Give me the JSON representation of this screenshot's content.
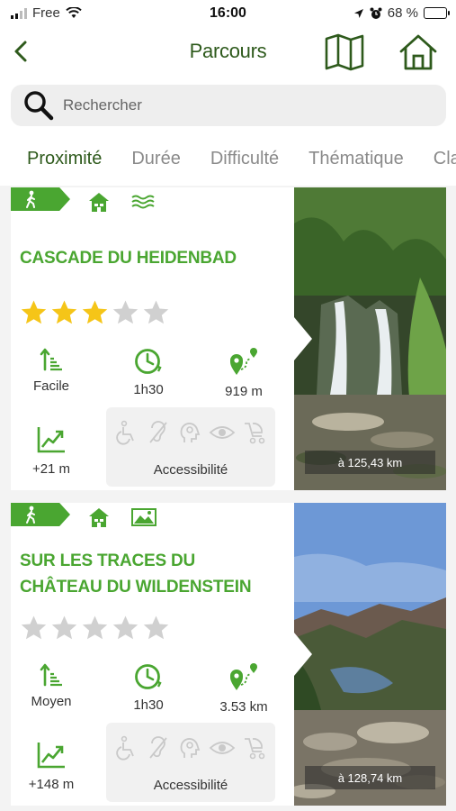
{
  "status_bar": {
    "carrier": "Free",
    "time": "16:00",
    "battery": "68 %",
    "battery_level": 0.68
  },
  "header": {
    "title": "Parcours",
    "back_icon": "chevron-left-icon",
    "map_icon": "map-icon",
    "home_icon": "home-icon"
  },
  "search": {
    "placeholder": "Rechercher",
    "value": ""
  },
  "tabs": [
    {
      "label": "Proximité",
      "active": true
    },
    {
      "label": "Durée",
      "active": false
    },
    {
      "label": "Difficulté",
      "active": false
    },
    {
      "label": "Thématique",
      "active": false
    },
    {
      "label": "Classem",
      "active": false
    }
  ],
  "colors": {
    "brand_green": "#4aa631",
    "title_green": "#2e5a1c",
    "star_gold": "#f5c518",
    "star_grey": "#d0d0d0"
  },
  "routes": [
    {
      "title": "Cascade du Heidenbad",
      "rating": 3,
      "max_rating": 5,
      "difficulty": "Facile",
      "duration": "1h30",
      "length": "919 m",
      "elevation": "+21 m",
      "accessibility_label": "Accessibilité",
      "distance": "à 125,43 km",
      "icons": [
        "hiker-icon",
        "house-icon",
        "water-icon"
      ],
      "photo": "waterfall"
    },
    {
      "title": "Sur les traces du château du Wildenstein",
      "rating": 0,
      "max_rating": 5,
      "difficulty": "Moyen",
      "duration": "1h30",
      "length": "3.53 km",
      "elevation": "+148 m",
      "accessibility_label": "Accessibilité",
      "distance": "à 128,74 km",
      "icons": [
        "hiker-icon",
        "house-icon",
        "landscape-icon"
      ],
      "photo": "valley-lake"
    }
  ]
}
